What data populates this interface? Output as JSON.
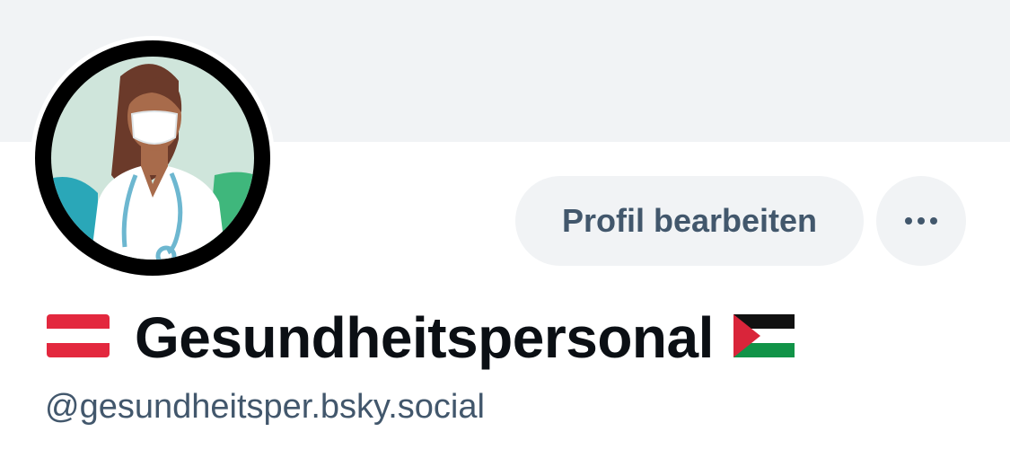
{
  "profile": {
    "display_name": "Gesundheitspersonal",
    "handle": "@gesundheitsper.bsky.social",
    "flags": {
      "left": "austria-flag",
      "right": "palestine-flag"
    }
  },
  "actions": {
    "edit_label": "Profil bearbeiten",
    "more_icon": "ellipsis-icon"
  },
  "colors": {
    "banner": "#f1f3f5",
    "button_bg": "#f1f3f5",
    "button_text": "#42576c",
    "name_text": "#0b0f14",
    "handle_text": "#42576c"
  }
}
